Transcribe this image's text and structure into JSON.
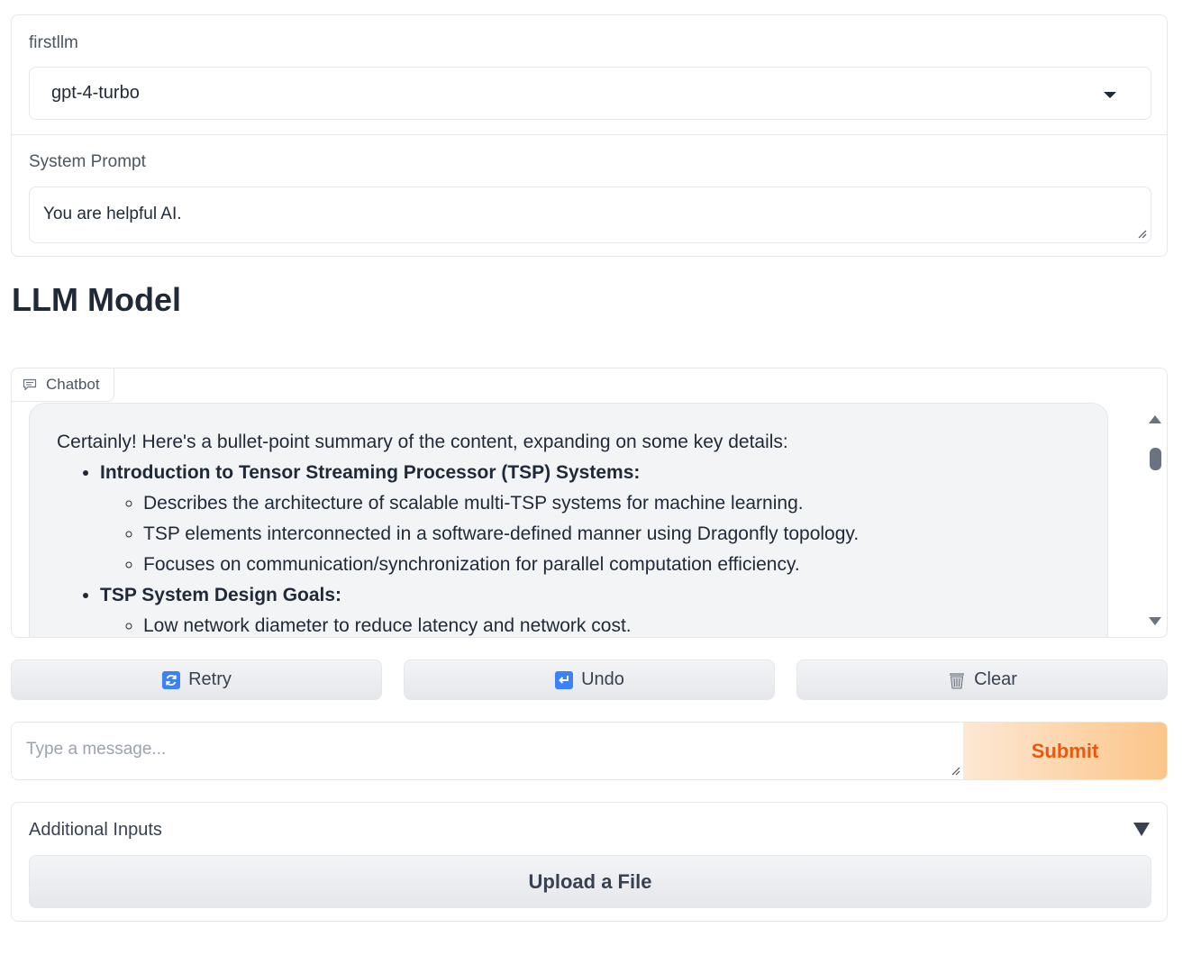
{
  "model_select": {
    "label": "firstllm",
    "value": "gpt-4-turbo"
  },
  "system_prompt": {
    "label": "System Prompt",
    "value": "You are helpful AI."
  },
  "heading": "LLM Model",
  "chatbot": {
    "tab_label": "Chatbot",
    "message": {
      "intro": "Certainly! Here's a bullet-point summary of the content, expanding on some key details:",
      "sections": [
        {
          "title": "Introduction to Tensor Streaming Processor (TSP) Systems:",
          "points": [
            "Describes the architecture of scalable multi-TSP systems for machine learning.",
            "TSP elements interconnected in a software-defined manner using Dragonfly topology.",
            "Focuses on communication/synchronization for parallel computation efficiency."
          ]
        },
        {
          "title": "TSP System Design Goals:",
          "points": [
            "Low network diameter to reduce latency and network cost."
          ]
        }
      ]
    }
  },
  "actions": {
    "retry": "Retry",
    "undo": "Undo",
    "clear": "Clear"
  },
  "composer": {
    "placeholder": "Type a message...",
    "submit": "Submit"
  },
  "additional_inputs": {
    "label": "Additional Inputs",
    "upload": "Upload a File"
  },
  "colors": {
    "accent": "#ea580c",
    "icon_blue": "#3b82f6"
  }
}
